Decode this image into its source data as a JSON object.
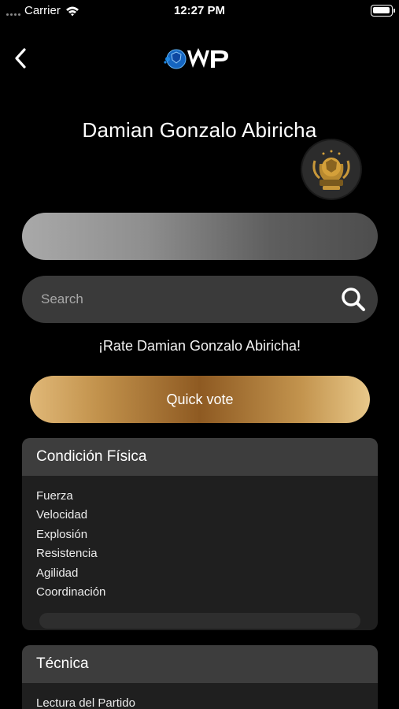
{
  "status_bar": {
    "carrier": "Carrier",
    "time": "12:27 PM"
  },
  "header": {
    "player_name": "Damian Gonzalo Abiricha"
  },
  "search": {
    "placeholder": "Search",
    "value": ""
  },
  "rate_text": "¡Rate Damian Gonzalo Abiricha!",
  "quick_vote_label": "Quick vote",
  "sections": [
    {
      "title": "Condición Física",
      "items": [
        "Fuerza",
        "Velocidad",
        "Explosión",
        "Resistencia",
        "Agilidad",
        "Coordinación"
      ]
    },
    {
      "title": "Técnica",
      "items": [
        "Lectura del Partido"
      ]
    }
  ],
  "colors": {
    "background": "#000000",
    "search_bg": "#3a3a3a",
    "section_header": "#3d3d3d",
    "section_body": "#1f1f1f",
    "gold": "#c2924c",
    "logo_blue": "#1e88e5"
  },
  "icons": {
    "back": "chevron-left-icon",
    "search": "search-icon",
    "wifi": "wifi-icon",
    "battery": "battery-icon"
  }
}
